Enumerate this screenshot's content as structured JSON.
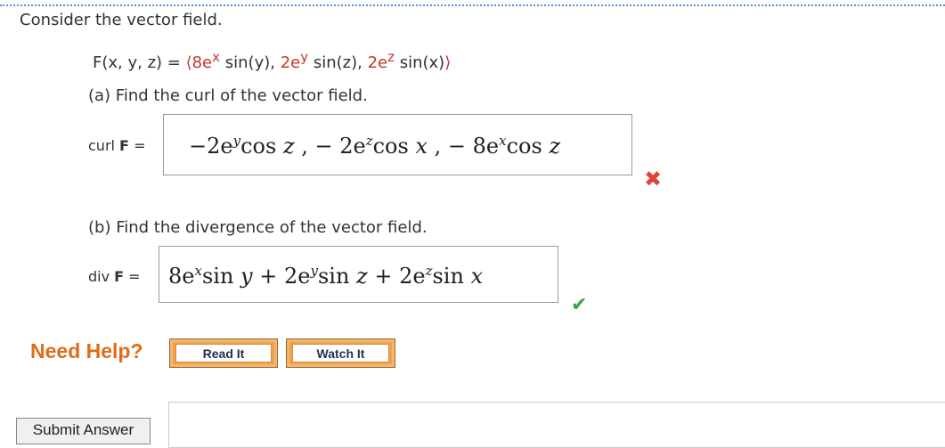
{
  "intro": "Consider the vector field.",
  "field": {
    "lhs": "F(x, y, z) =",
    "open": "⟨",
    "c1": "8e",
    "c1_sup": "x",
    "c1_rest": " sin(y), ",
    "c2": "2e",
    "c2_sup": "y",
    "c2_rest": " sin(z), ",
    "c3": "2e",
    "c3_sup": "z",
    "c3_rest": " sin(x)",
    "close": "⟩"
  },
  "part_a": {
    "question": "(a) Find the curl of the vector field.",
    "label_prefix": "curl ",
    "label_bold": "F",
    "label_suffix": " =",
    "answer": {
      "t1": "−2e",
      "t1_sup": "y",
      "t1_fn": "cos",
      "t1_var": "z",
      "sep1": " , − ",
      "t2": "2e",
      "t2_sup": "z",
      "t2_fn": "cos",
      "t2_var": "x",
      "sep2": " , − ",
      "t3": "8e",
      "t3_sup": "x",
      "t3_fn": "cos",
      "t3_var": "z"
    },
    "status": "incorrect"
  },
  "part_b": {
    "question": "(b) Find the divergence of the vector field.",
    "label_prefix": "div ",
    "label_bold": "F",
    "label_suffix": " =",
    "answer": {
      "t1": "8e",
      "t1_sup": "x",
      "t1_fn": "sin",
      "t1_var": "y",
      "sep1": " + ",
      "t2": "2e",
      "t2_sup": "y",
      "t2_fn": "sin",
      "t2_var": "z",
      "sep2": " + ",
      "t3": "2e",
      "t3_sup": "z",
      "t3_fn": "sin",
      "t3_var": "x"
    },
    "status": "correct"
  },
  "help": {
    "title": "Need Help?",
    "read_it": "Read It",
    "watch_it": "Watch It"
  },
  "submit": "Submit Answer",
  "icons": {
    "incorrect": "✖",
    "correct": "✔"
  },
  "colors": {
    "incorrect": "#e0413b",
    "correct": "#3aa24b",
    "need_help": "#e06c1b",
    "button": "#f0a24b"
  }
}
